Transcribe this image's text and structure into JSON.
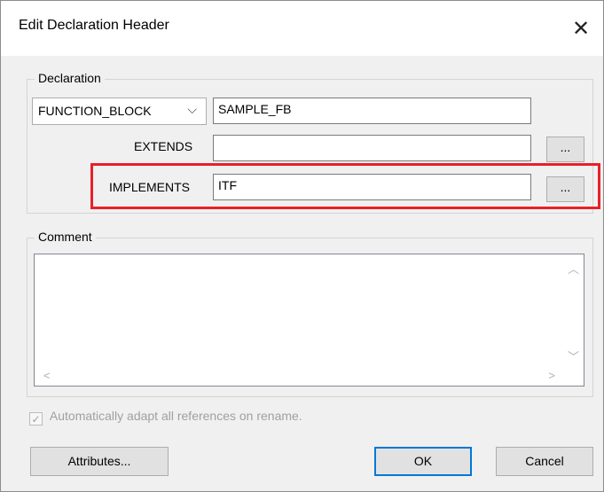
{
  "dialog": {
    "title": "Edit Declaration Header",
    "close_glyph": "✕"
  },
  "declaration": {
    "legend": "Declaration",
    "kind_value": "FUNCTION_BLOCK",
    "kind_arrow": "⌵",
    "name_value": "SAMPLE_FB",
    "extends_label": "EXTENDS",
    "extends_value": "",
    "extends_browse": "...",
    "implements_label": "IMPLEMENTS",
    "implements_value": "ITF",
    "implements_browse": "..."
  },
  "comment": {
    "legend": "Comment",
    "value": "",
    "scroll_up": "︿",
    "scroll_down": "﹀",
    "scroll_left": "<",
    "scroll_right": ">"
  },
  "options": {
    "adapt_refs_label": "Automatically adapt all references on rename.",
    "adapt_refs_checked": true,
    "check_glyph": "✓"
  },
  "buttons": {
    "attributes": "Attributes...",
    "ok": "OK",
    "cancel": "Cancel"
  },
  "colors": {
    "highlight": "#e8202a",
    "default_button_border": "#0078d7"
  },
  "icons": {
    "close": "close-icon",
    "dropdown": "chevron-down-icon",
    "check": "checkmark-icon"
  }
}
